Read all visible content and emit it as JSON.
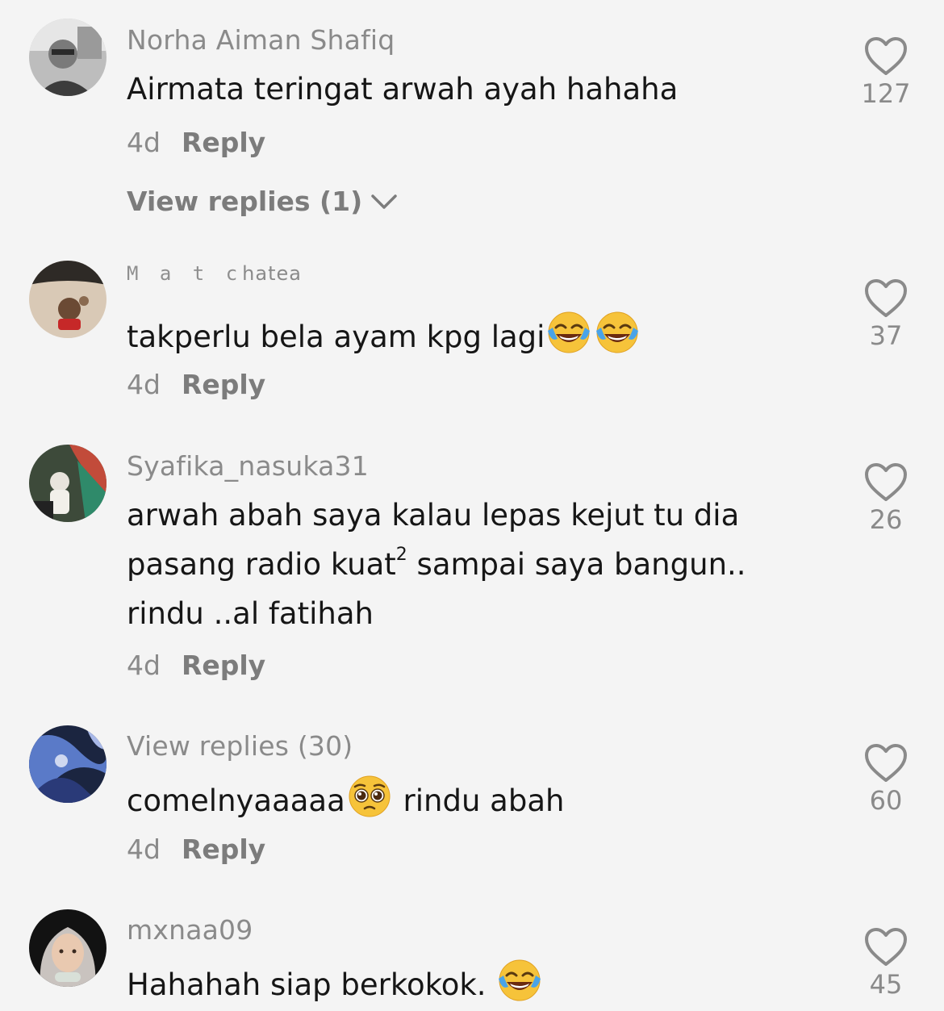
{
  "comments": [
    {
      "username": "Norha Aiman Shafiq",
      "text": "Airmata teringat arwah ayah hahaha",
      "date": "4d",
      "reply_label": "Reply",
      "likes": "127",
      "view_replies": "View replies (1)"
    },
    {
      "username_spaced": "M a t c",
      "username_rest": "hatea",
      "text": "takperlu bela ayam kpg lagi",
      "emoji": [
        "face-with-tears-of-joy",
        "face-with-tears-of-joy"
      ],
      "date": "4d",
      "reply_label": "Reply",
      "likes": "37"
    },
    {
      "username": "Syafika_nasuka31",
      "text_line1": "arwah abah saya kalau lepas kejut tu dia",
      "text_line2_a": "pasang radio kuat",
      "text_line2_sup": "2",
      "text_line2_b": " sampai saya bangun..",
      "text_line3": "rindu ..al fatihah",
      "date": "4d",
      "reply_label": "Reply",
      "likes": "26"
    },
    {
      "username": "View replies (30)",
      "text_a": "comelnyaaaaa",
      "emoji": [
        "pleading-face"
      ],
      "text_b": " rindu abah",
      "date": "4d",
      "reply_label": "Reply",
      "likes": "60"
    },
    {
      "username": "mxnaa09",
      "text": "Hahahah siap berkokok. ",
      "emoji": [
        "face-with-tears-of-joy"
      ],
      "likes": "45"
    }
  ]
}
